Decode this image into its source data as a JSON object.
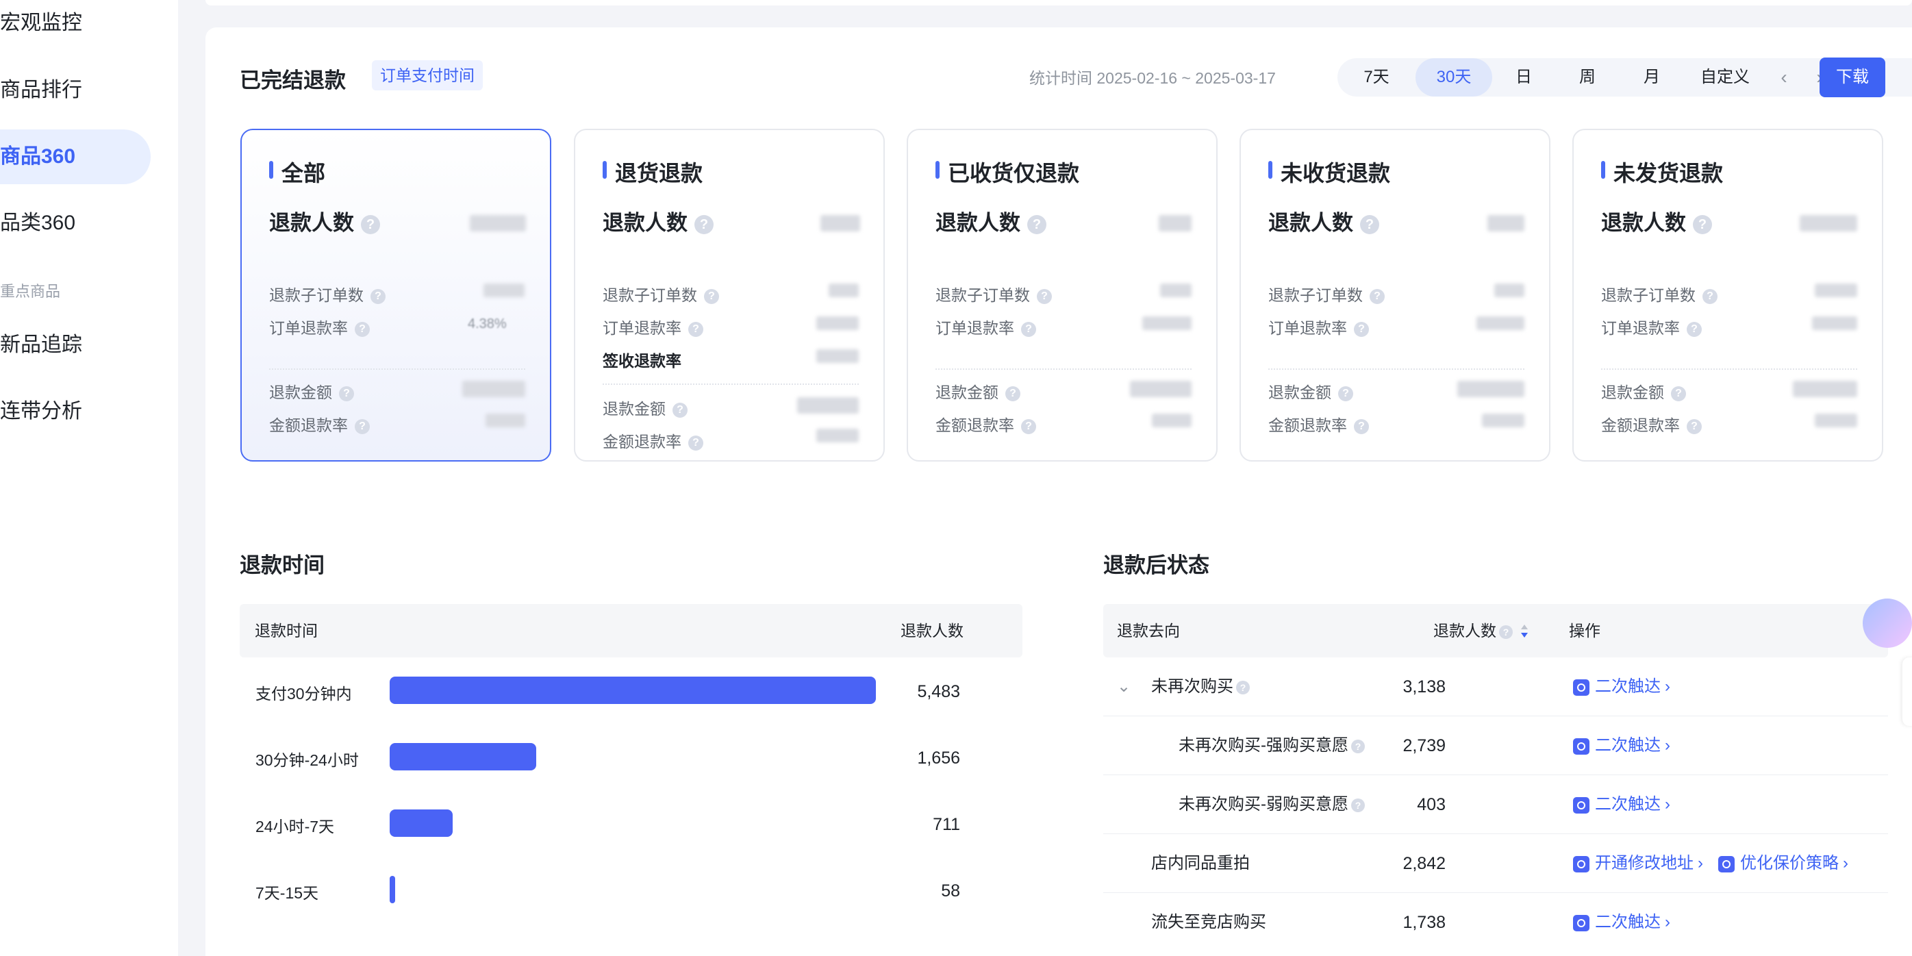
{
  "sidebar": {
    "items": [
      {
        "label": "宏观监控"
      },
      {
        "label": "商品排行"
      },
      {
        "label": "商品360"
      },
      {
        "label": "品类360"
      },
      {
        "label": "新品追踪"
      },
      {
        "label": "连带分析"
      }
    ],
    "group_label": "重点商品",
    "active": "商品360"
  },
  "header": {
    "title": "已完结退款",
    "filter_pill": "订单支付时间",
    "range_label": "统计时间 2025-02-16 ~ 2025-03-17",
    "periods": [
      "7天",
      "30天",
      "日",
      "周",
      "月",
      "自定义"
    ],
    "active_period": "30天",
    "prev": "‹",
    "next": "›",
    "download": "下载"
  },
  "cards": [
    {
      "title": "全部",
      "main_label": "退款人数",
      "metrics": [
        "退款子订单数",
        "订单退款率"
      ],
      "metrics2": [
        "退款金额",
        "金额退款率"
      ],
      "partial_value": "4.38%"
    },
    {
      "title": "退货退款",
      "main_label": "退款人数",
      "metrics": [
        "退款子订单数",
        "订单退款率",
        "签收退款率"
      ],
      "metrics2": [
        "退款金额",
        "金额退款率"
      ]
    },
    {
      "title": "已收货仅退款",
      "main_label": "退款人数",
      "metrics": [
        "退款子订单数",
        "订单退款率"
      ],
      "metrics2": [
        "退款金额",
        "金额退款率"
      ]
    },
    {
      "title": "未收货退款",
      "main_label": "退款人数",
      "metrics": [
        "退款子订单数",
        "订单退款率"
      ],
      "metrics2": [
        "退款金额",
        "金额退款率"
      ]
    },
    {
      "title": "未发货退款",
      "main_label": "退款人数",
      "metrics": [
        "退款子订单数",
        "订单退款率"
      ],
      "metrics2": [
        "退款金额",
        "金额退款率"
      ]
    }
  ],
  "refund_time": {
    "title": "退款时间",
    "col_time": "退款时间",
    "col_count": "退款人数",
    "rows": [
      {
        "label": "支付30分钟内",
        "value": "5,483",
        "num": 5483
      },
      {
        "label": "30分钟-24小时",
        "value": "1,656",
        "num": 1656
      },
      {
        "label": "24小时-7天",
        "value": "711",
        "num": 711
      },
      {
        "label": "7天-15天",
        "value": "58",
        "num": 58
      }
    ]
  },
  "status": {
    "title": "退款后状态",
    "col_dest": "退款去向",
    "col_count": "退款人数",
    "col_action": "操作",
    "rows": [
      {
        "label": "未再次购买",
        "value": "3,138",
        "actions": [
          "二次触达"
        ]
      },
      {
        "label": "未再次购买-强购买意愿",
        "value": "2,739",
        "actions": [
          "二次触达"
        ]
      },
      {
        "label": "未再次购买-弱购买意愿",
        "value": "403",
        "actions": [
          "二次触达"
        ]
      },
      {
        "label": "店内同品重拍",
        "value": "2,842",
        "actions": [
          "开通修改地址",
          "优化保价策略"
        ]
      },
      {
        "label": "流失至竞店购买",
        "value": "1,738",
        "actions": [
          "二次触达"
        ]
      }
    ]
  },
  "colors": {
    "accent": "#3e63f4",
    "bar": "#4a63f5"
  }
}
